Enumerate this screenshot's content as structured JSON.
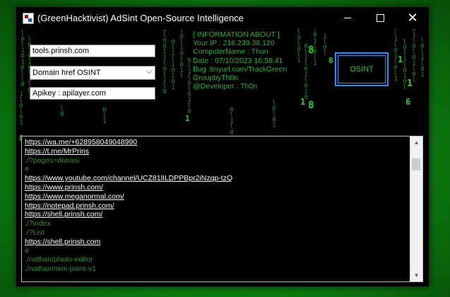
{
  "window": {
    "title": "(GreenHacktivist) AdSint Open-Source Intelligence",
    "controls": {
      "minimize": "minimize",
      "maximize": "maximize",
      "close": "✕"
    }
  },
  "form": {
    "target_value": "tools.prinsh.com",
    "mode_selected": "Domain href OSINT",
    "apikey_value": "Apikey : apilayer.com",
    "osint_button": "OSINT"
  },
  "info": {
    "header": "[ INFORMATION ABOUT ]",
    "ip": "Your IP : 216.239.38.120",
    "computer": "ComputerName : Thon",
    "date": "Date : 07/10/2023 16:58:41",
    "bug": "Bug :tinyurl.com/TrackGreen",
    "group": "GroupbyTh0n",
    "developer": "@Developer : Th0n"
  },
  "output_lines": [
    {
      "text": "https://wa.me/+628958049048990",
      "style": "link"
    },
    {
      "text": "https://t.me/MrPrins",
      "style": "link"
    },
    {
      "text": "./?pages=donasi",
      "style": "dim"
    },
    {
      "text": "#",
      "style": "dim"
    },
    {
      "text": "https://www.youtube.com/channel/UCZ81lILDPPBpr2iNzqp-tzQ",
      "style": "link"
    },
    {
      "text": "https://www.prinsh.com/",
      "style": "link"
    },
    {
      "text": "https://www.meganormal.com/",
      "style": "link"
    },
    {
      "text": "https://notepad.prinsh.com/",
      "style": "link"
    },
    {
      "text": "https://shell.prinsh.com/",
      "style": "link"
    },
    {
      "text": "./?index",
      "style": "dim"
    },
    {
      "text": "./?List",
      "style": "dim"
    },
    {
      "text": "https://shell.prinsh.com",
      "style": "link"
    },
    {
      "text": "#",
      "style": "dim"
    },
    {
      "text": "./nathan/photo-editor",
      "style": "dim"
    },
    {
      "text": "./nathan/mini-paint-v1",
      "style": "dim"
    }
  ],
  "colors": {
    "accent_green": "#1fb82a",
    "button_border": "#1e90ff",
    "link_text": "#ffffff"
  },
  "icons": {
    "app": "app-icon",
    "dropdown": "chevron-down-icon",
    "scroll_up": "scroll-up-icon",
    "scroll_down": "scroll-down-icon"
  }
}
